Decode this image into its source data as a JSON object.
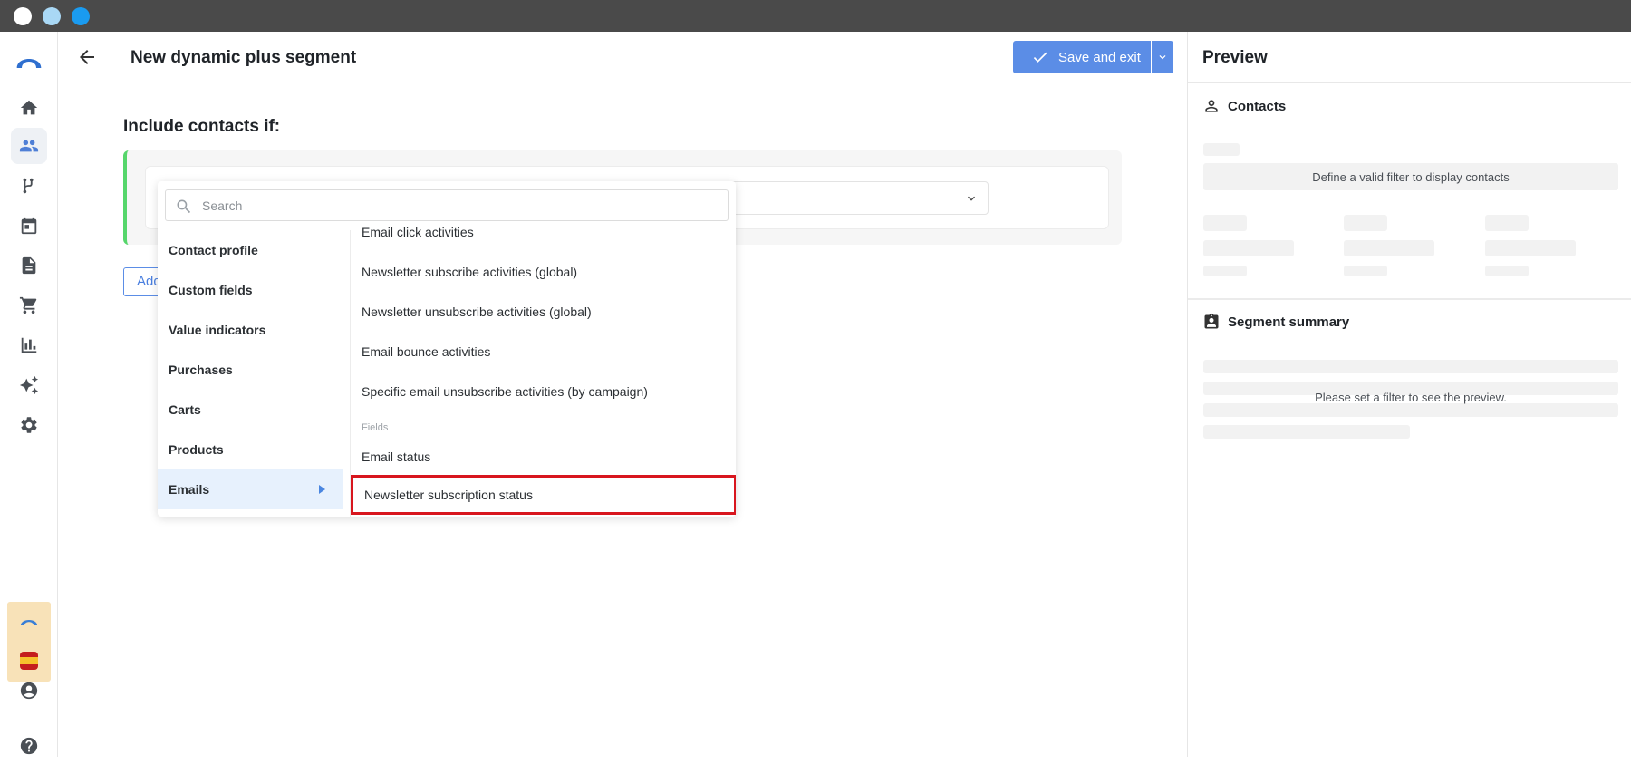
{
  "window": {
    "traffic_lights": [
      "close",
      "minimize",
      "zoom"
    ]
  },
  "sidebar": {
    "items": [
      {
        "name": "logo-icon"
      },
      {
        "name": "home-icon"
      },
      {
        "name": "contacts-icon",
        "active": true
      },
      {
        "name": "automation-icon"
      },
      {
        "name": "calendar-icon"
      },
      {
        "name": "document-icon"
      },
      {
        "name": "cart-icon"
      },
      {
        "name": "reports-icon"
      },
      {
        "name": "sparkles-icon"
      },
      {
        "name": "settings-icon"
      },
      {
        "name": "account-icon"
      },
      {
        "name": "help-icon"
      }
    ]
  },
  "header": {
    "title": "New dynamic plus segment",
    "save_label": "Save and exit"
  },
  "main": {
    "include_label": "Include contacts if:",
    "add_button_label": "Add"
  },
  "dropdown": {
    "search_placeholder": "Search",
    "categories": [
      {
        "label": "Contact profile"
      },
      {
        "label": "Custom fields"
      },
      {
        "label": "Value indicators"
      },
      {
        "label": "Purchases"
      },
      {
        "label": "Carts"
      },
      {
        "label": "Products"
      },
      {
        "label": "Emails",
        "active": true
      }
    ],
    "options_activities": [
      "Email click activities",
      "Newsletter subscribe activities (global)",
      "Newsletter unsubscribe activities (global)",
      "Email bounce activities",
      "Specific email unsubscribe activities (by campaign)"
    ],
    "fields_group_label": "Fields",
    "options_fields": [
      "Email status",
      "Newsletter subscription status"
    ]
  },
  "preview": {
    "title": "Preview",
    "contacts_title": "Contacts",
    "contacts_message": "Define a valid filter to display contacts",
    "summary_title": "Segment summary",
    "summary_message": "Please set a filter to see the preview."
  },
  "colors": {
    "accent": "#5b8de6",
    "rule_border": "#56d66b",
    "highlight": "#d8161e",
    "active_category_bg": "#e7f1fd"
  }
}
